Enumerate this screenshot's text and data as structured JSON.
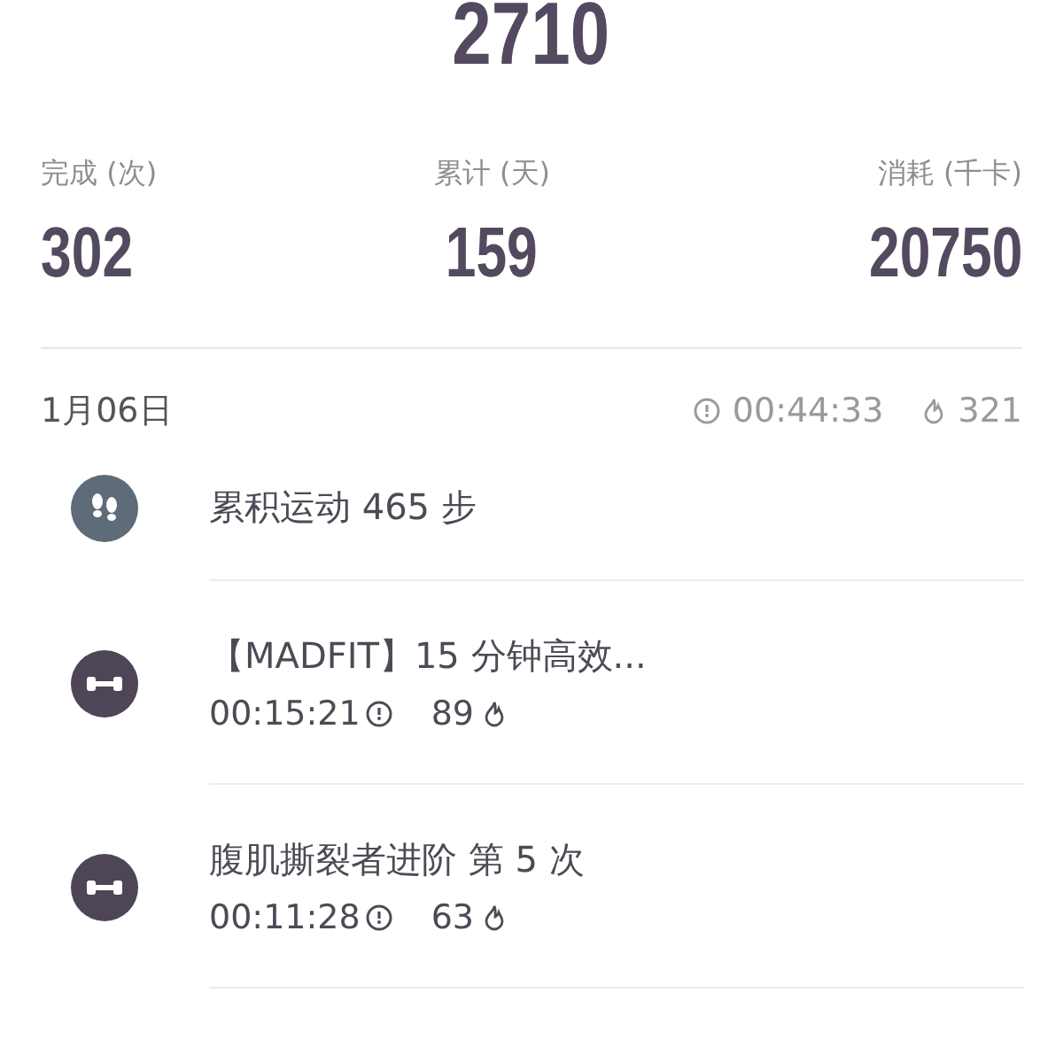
{
  "total": "2710",
  "stats": [
    {
      "label": "完成 (次)",
      "value": "302"
    },
    {
      "label": "累计 (天)",
      "value": "159"
    },
    {
      "label": "消耗 (千卡)",
      "value": "20750"
    }
  ],
  "day": {
    "date": "1月06日",
    "duration": "00:44:33",
    "calories": "321"
  },
  "records": [
    {
      "kind": "steps",
      "title": "累积运动 465 步"
    },
    {
      "kind": "workout",
      "title": "【MADFIT】15 分钟高效...",
      "duration": "00:15:21",
      "calories": "89"
    },
    {
      "kind": "workout",
      "title": "腹肌撕裂者进阶  第 5 次",
      "duration": "00:11:28",
      "calories": "63"
    }
  ]
}
